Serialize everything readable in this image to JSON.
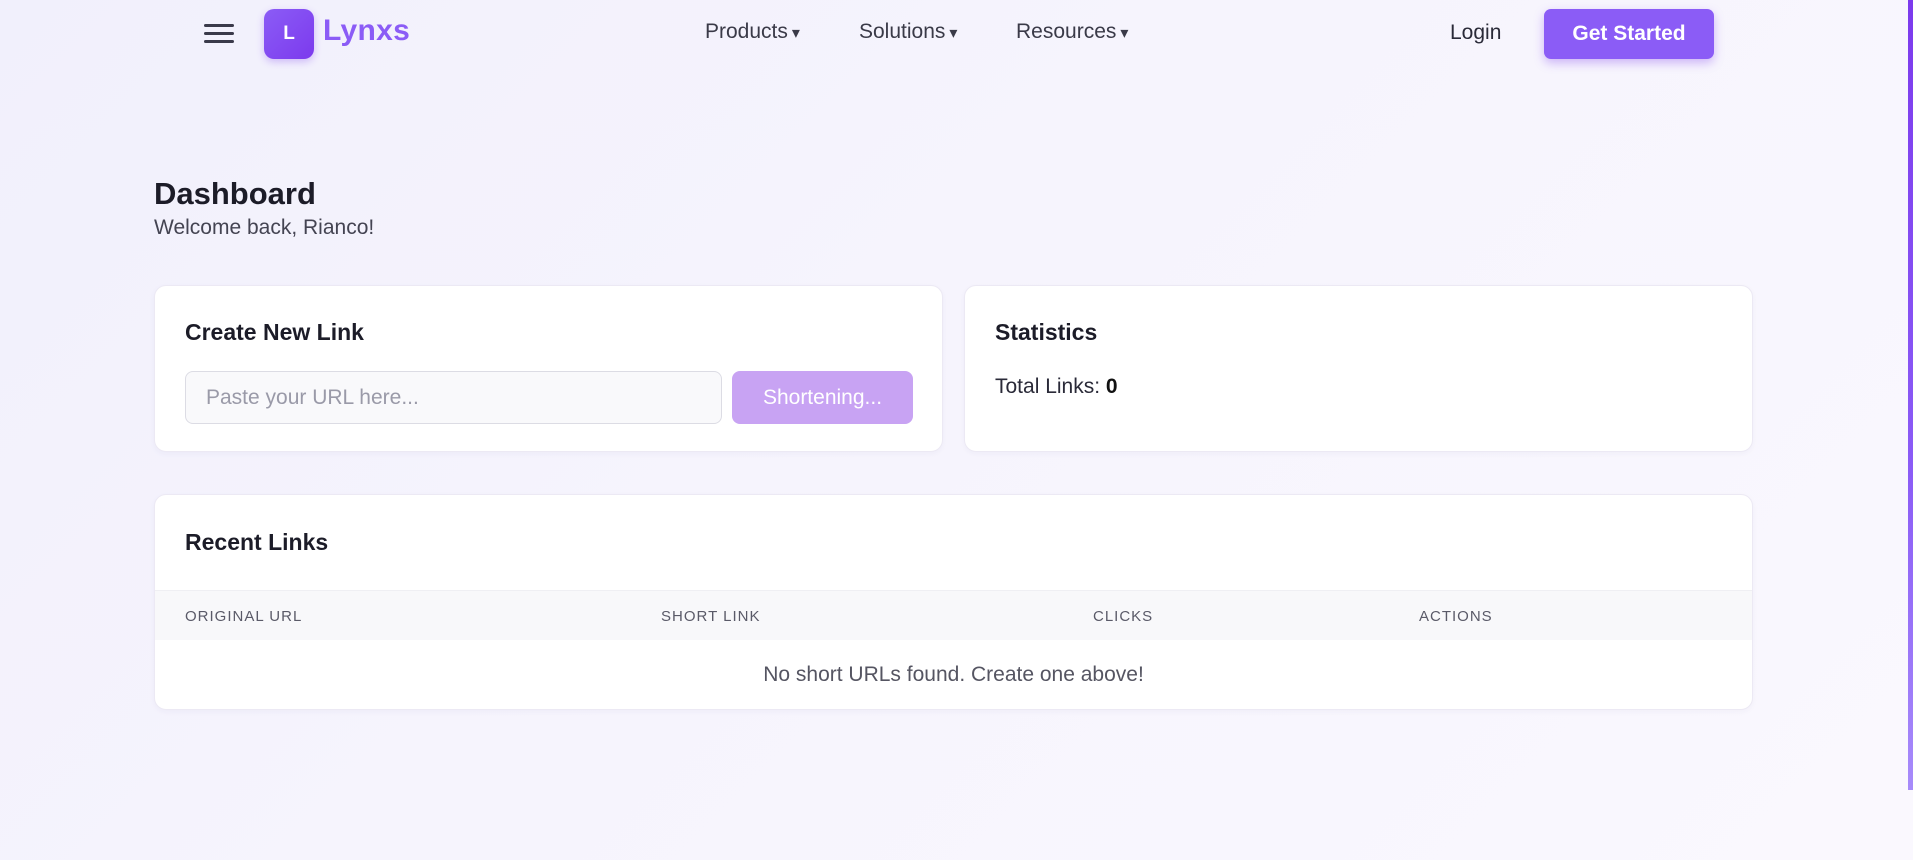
{
  "header": {
    "logo_letter": "L",
    "brand": "Lynxs",
    "nav": [
      {
        "label": "Products",
        "caret": "▾"
      },
      {
        "label": "Solutions",
        "caret": "▾"
      },
      {
        "label": "Resources",
        "caret": "▾"
      }
    ],
    "login_label": "Login",
    "cta_label": "Get Started"
  },
  "page": {
    "title": "Dashboard",
    "welcome": "Welcome back, Rianco!"
  },
  "create_card": {
    "title": "Create New Link",
    "input_placeholder": "Paste your URL here...",
    "input_value": "",
    "button_label": "Shortening..."
  },
  "stats_card": {
    "title": "Statistics",
    "total_label": "Total Links:",
    "total_value": "0"
  },
  "recent": {
    "title": "Recent Links",
    "columns": [
      "ORIGINAL URL",
      "SHORT LINK",
      "CLICKS",
      "ACTIONS"
    ],
    "rows": [],
    "empty_message": "No short URLs found. Create one above!"
  },
  "colors": {
    "accent": "#8b5cf6",
    "accent_dark": "#7c3aed",
    "button_disabled": "#c8a3f3",
    "background": "#f3f1fc"
  },
  "icons": {
    "menu": "hamburger-menu-icon",
    "dropdown": "chevron-down-icon"
  }
}
